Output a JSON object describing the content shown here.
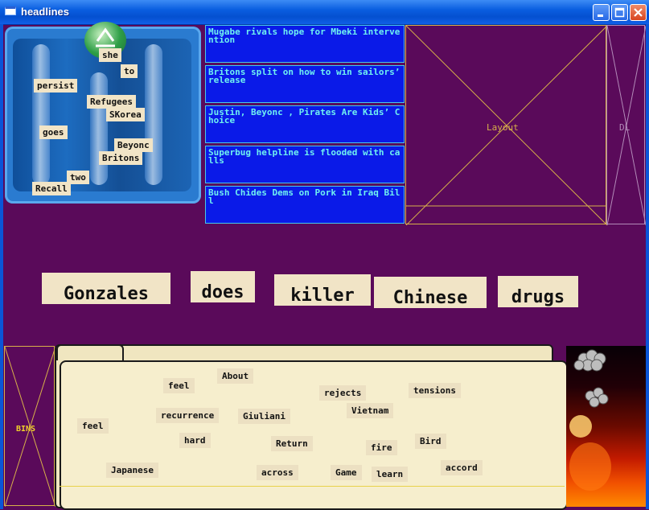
{
  "window": {
    "title": "headlines"
  },
  "recycler_words": [
    "she",
    "to",
    "persist",
    "Refugees",
    "SKorea",
    "goes",
    "Beyonc",
    "Britons",
    "two",
    "Recall"
  ],
  "headlines": [
    "Mugabe rivals hope for Mbeki intervention",
    "Britons split on how to win sailors’ release",
    "Justin, Beyonc , Pirates Are Kids’ Choice",
    "Superbug helpline is flooded with calls",
    "Bush Chides Dems on Pork in Iraq Bill"
  ],
  "layout_label": "Layout",
  "dl_label": "DL",
  "bins_label": "BINS",
  "big_words": [
    "Gonzales",
    "does",
    "killer",
    "Chinese",
    "drugs"
  ],
  "folder_words": [
    "About",
    "feel",
    "rejects",
    "tensions",
    "Vietnam",
    "recurrence",
    "Giuliani",
    "feel",
    "hard",
    "Return",
    "Bird",
    "fire",
    "Japanese",
    "across",
    "Game",
    "learn",
    "accord"
  ]
}
